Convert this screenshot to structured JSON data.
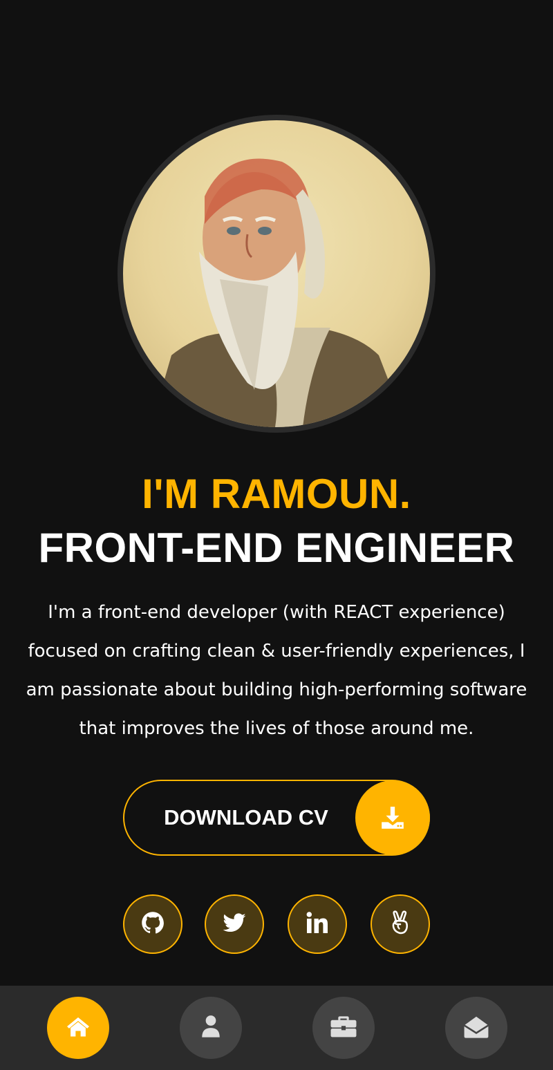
{
  "hero": {
    "name": "I'M RAMOUN.",
    "role": "FRONT-END ENGINEER",
    "bio": "I'm a front-end developer (with REACT experience) focused on crafting clean & user-friendly experiences, I am passionate about building high-performing software that improves the lives of those around me."
  },
  "cv_button": {
    "label": "DOWNLOAD CV",
    "icon": "download-icon"
  },
  "social_links": [
    {
      "name": "github",
      "icon": "github-icon"
    },
    {
      "name": "twitter",
      "icon": "twitter-icon"
    },
    {
      "name": "linkedin",
      "icon": "linkedin-icon"
    },
    {
      "name": "angellist",
      "icon": "angellist-icon"
    }
  ],
  "nav": {
    "items": [
      {
        "name": "home",
        "icon": "home-icon",
        "active": true
      },
      {
        "name": "about",
        "icon": "user-icon",
        "active": false
      },
      {
        "name": "portfolio",
        "icon": "briefcase-icon",
        "active": false
      },
      {
        "name": "contact",
        "icon": "envelope-open-icon",
        "active": false
      }
    ]
  },
  "colors": {
    "accent": "#ffb400",
    "background": "#111111",
    "nav_background": "#2b2b2b",
    "nav_inactive": "#444444"
  }
}
